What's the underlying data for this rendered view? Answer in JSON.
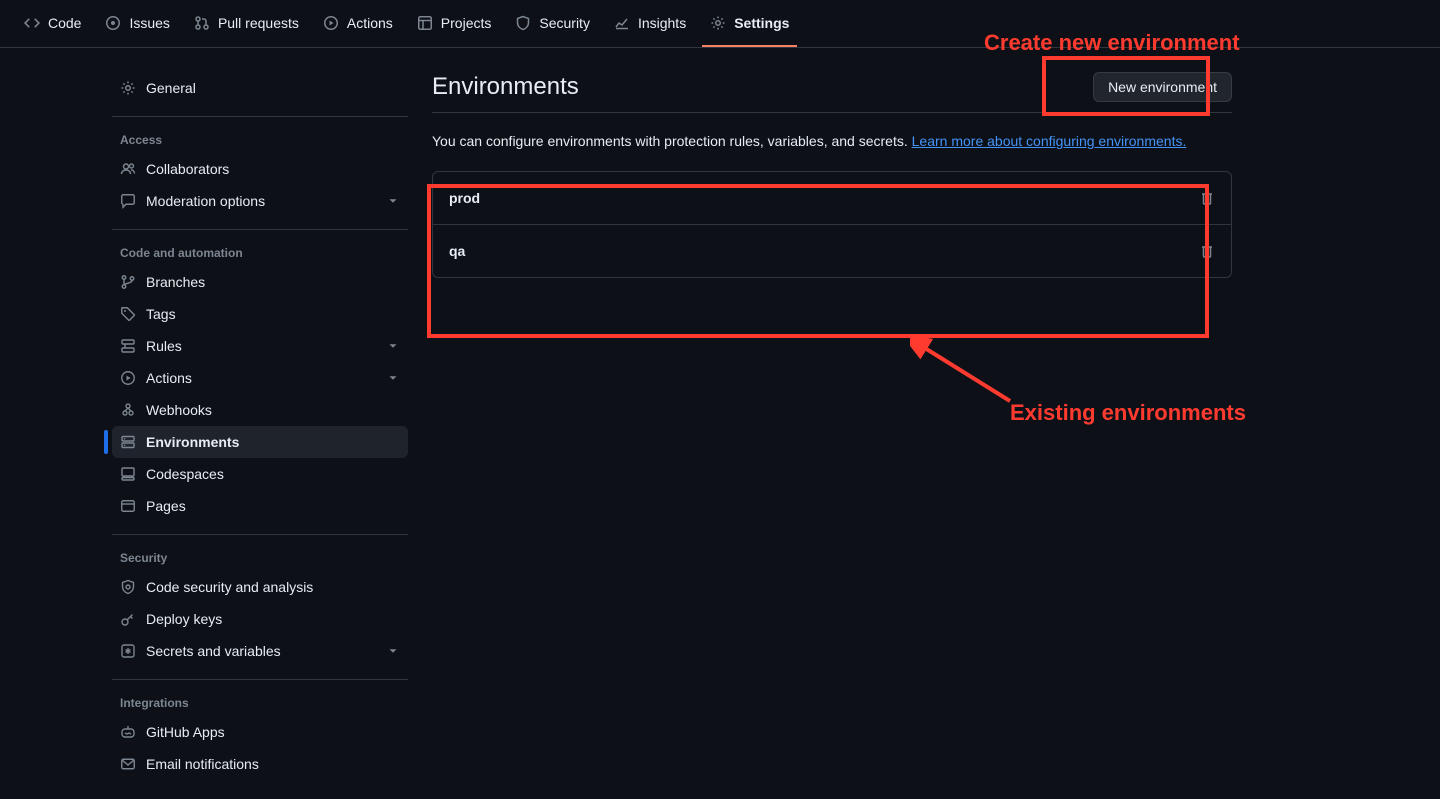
{
  "repo_nav": {
    "tabs": [
      {
        "label": "Code"
      },
      {
        "label": "Issues"
      },
      {
        "label": "Pull requests"
      },
      {
        "label": "Actions"
      },
      {
        "label": "Projects"
      },
      {
        "label": "Security"
      },
      {
        "label": "Insights"
      },
      {
        "label": "Settings"
      }
    ],
    "active_idx": 7
  },
  "sidebar": {
    "general": "General",
    "section_access": "Access",
    "collaborators": "Collaborators",
    "moderation": "Moderation options",
    "section_code_auto": "Code and automation",
    "branches": "Branches",
    "tags": "Tags",
    "rules": "Rules",
    "actions": "Actions",
    "webhooks": "Webhooks",
    "environments": "Environments",
    "codespaces": "Codespaces",
    "pages": "Pages",
    "section_security": "Security",
    "code_security": "Code security and analysis",
    "deploy_keys": "Deploy keys",
    "secrets_vars": "Secrets and variables",
    "section_integrations": "Integrations",
    "github_apps": "GitHub Apps",
    "email_notifications": "Email notifications"
  },
  "main": {
    "heading": "Environments",
    "new_btn": "New environment",
    "desc_text": "You can configure environments with protection rules, variables, and secrets. ",
    "desc_link": "Learn more about configuring environments.",
    "environments": [
      {
        "name": "prod"
      },
      {
        "name": "qa"
      }
    ]
  },
  "annotations": {
    "create_label": "Create new environment",
    "existing_label": "Existing environments"
  }
}
